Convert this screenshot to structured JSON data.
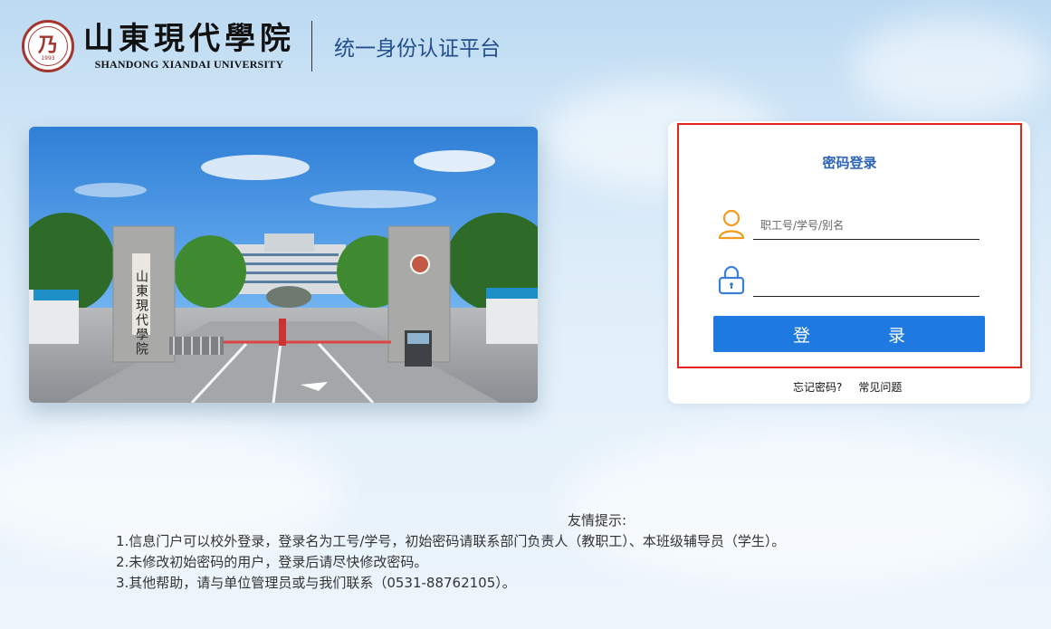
{
  "header": {
    "seal_year": "1993",
    "school_name_cn": "山東現代學院",
    "school_name_en": "SHANDONG XIANDAI UNIVERSITY",
    "platform_title": "统一身份认证平台"
  },
  "login": {
    "title": "密码登录",
    "username_placeholder": "职工号/学号/别名",
    "password_placeholder": "",
    "submit_label": "登 录",
    "forgot_password": "忘记密码?",
    "faq": "常见问题"
  },
  "tips": {
    "title": "友情提示:",
    "items": [
      "1.信息门户可以校外登录，登录名为工号/学号，初始密码请联系部门负责人（教职工）、本班级辅导员（学生）。",
      "2.未修改初始密码的用户，登录后请尽快修改密码。",
      "3.其他帮助，请与单位管理员或与我们联系（0531-88762105）。"
    ]
  },
  "photo": {
    "gate_inscription": "山東現代學院"
  },
  "colors": {
    "brand_blue": "#2b64b8",
    "button_blue": "#1e7ae0",
    "highlight_red": "#e0251c",
    "icon_orange": "#f29b1e",
    "icon_blue": "#3d7fd6"
  }
}
